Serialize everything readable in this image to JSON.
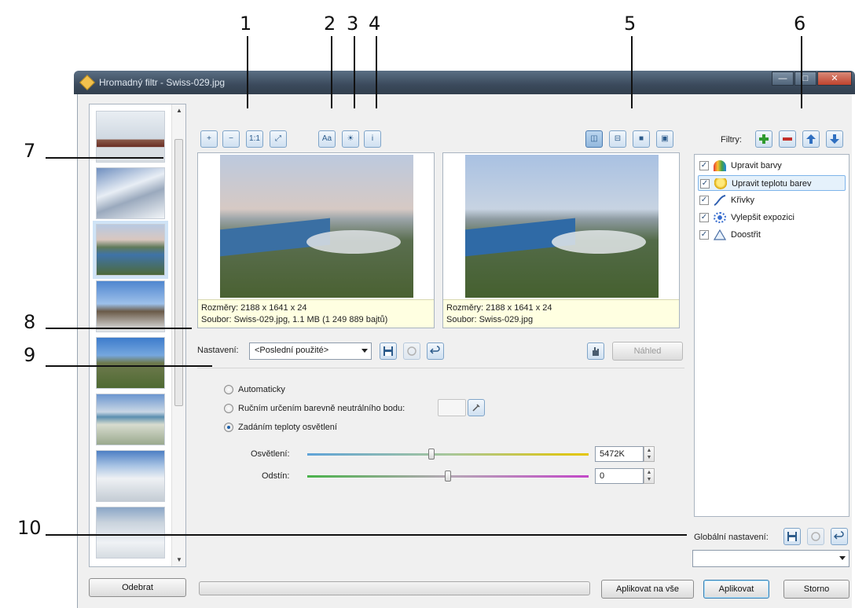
{
  "callouts": [
    "1",
    "2",
    "3",
    "4",
    "5",
    "6",
    "7",
    "8",
    "9",
    "10"
  ],
  "window": {
    "title": "Hromadný filtr - Swiss-029.jpg",
    "minimize": "—",
    "maximize": "□",
    "close": "✕"
  },
  "thumbnails": [
    "train-snow",
    "mountains-snow",
    "lake-valley",
    "rock-peak",
    "green-cliff",
    "alpine-lake",
    "snowfield",
    "hiker-snow"
  ],
  "toolbar": {
    "zoom_in": "+",
    "zoom_out": "−",
    "actual_size": "1:1",
    "fit": "⤢",
    "compare": "Aa",
    "highlight": "☀",
    "info": "i",
    "view_side": "◫",
    "view_stacked": "⊟",
    "view_single": "■",
    "view_original": "▣"
  },
  "preview_left": {
    "dims": "Rozměry: 2188 x 1641 x 24",
    "file": "Soubor: Swiss-029.jpg, 1.1 MB (1 249 889 bajtů)"
  },
  "preview_right": {
    "dims": "Rozměry: 2188 x 1641 x 24",
    "file": "Soubor: Swiss-029.jpg"
  },
  "settings": {
    "label": "Nastavení:",
    "preset": "<Poslední použité>",
    "preview_button": "Náhled"
  },
  "options": {
    "auto": "Automaticky",
    "neutral_point": "Ručním určením barevně neutrálního bodu:",
    "temperature": "Zadáním teploty osvětlení"
  },
  "sliders": {
    "lighting_label": "Osvětlení:",
    "lighting_value": "5472K",
    "lighting_position": 0.44,
    "tint_label": "Odstín:",
    "tint_value": "0",
    "tint_position": 0.5
  },
  "filters": {
    "label": "Filtry:",
    "items": [
      "Upravit barvy",
      "Upravit teplotu barev",
      "Křivky",
      "Vylepšit expozici",
      "Doostřit"
    ],
    "selected": 1
  },
  "global": {
    "label": "Globální nastavení:",
    "preset": ""
  },
  "bottom": {
    "remove": "Odebrat",
    "apply_all": "Aplikovat na vše",
    "apply": "Aplikovat",
    "cancel": "Storno"
  },
  "colors": {
    "accent": "#3c7fb1",
    "info_bg": "#ffffe1",
    "selection": "#e5f1fb"
  }
}
